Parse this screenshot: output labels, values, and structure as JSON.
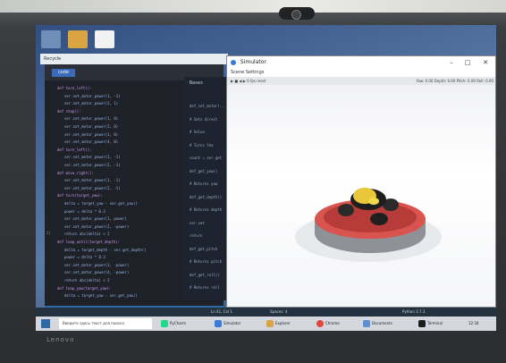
{
  "desktop": {
    "icon_labels": []
  },
  "explorer": {
    "title": "Recycle"
  },
  "code_window": {
    "tab_label": "code",
    "lines": [
      "def turn_left():",
      "    ser.set_motor_power(1, -1)",
      "    ser.set_motor_power(2, 1)",
      "def stop():",
      "    ser.set_motor_power(1, 0)",
      "    ser.set_motor_power(2, 0)",
      "    ser.set_motor_power(3, 0)",
      "    ser.set_motor_power(4, 0)",
      "def turn_left():",
      "    ser.set_motor_power(1, -1)",
      "    ser.set_motor_power(2, -1)",
      "def move_right():",
      "    ser.set_motor_power(1, -1)",
      "    ser.set_motor_power(2, -1)",
      "def turn(target_yaw):",
      "    delta = target_yaw - ser.get_yaw()",
      "    power = delta * 0.3",
      "    ser.set_motor_power(1, power)",
      "    ser.set_motor_power(2, -power)",
      "    return abs(delta) < 2",
      "def loop_until(target_depth):",
      "    delta = target_depth - ser.get_depth()",
      "    power = delta * 0.3",
      "    ser.set_motor_power(3, -power)",
      "    ser.set_motor_power(4, -power)",
      "    return abs(delta) < 2",
      "def loop_yaw(target_yaw):",
      "    delta = target_yaw - ser.get_yaw()"
    ],
    "line_number": "41",
    "status_path": "C:/Users/2022/mission/example/try_out_pool.py"
  },
  "mid_pane": {
    "header": "Bases",
    "lines": [
      "def_set_motor(..",
      "# Sets direct",
      "# Value",
      "# Turns the",
      "count = ser.get",
      "def_get_yaw()",
      "# Returns yaw",
      "def_get_depth()",
      "# Returns depth",
      "ser.set",
      "return",
      "def_get_pitch",
      "# Returns pitch",
      "def_get_roll()",
      "# Returns roll"
    ]
  },
  "sim_window": {
    "title": "Simulator",
    "menu": "Scene  Settings",
    "toolbar_left": "▶ ■ ◀ ▶  6 fps  reset",
    "toolbar_right": "Yaw: 0.00  Depth: 0.00  Pitch: 0.00  Roll: 0.00"
  },
  "statusbar": {
    "left": "Ln 41, Col 1",
    "mid": "Spaces: 4",
    "right": "Python 3.7.3"
  },
  "taskbar": {
    "search_placeholder": "Введите здесь текст для поиска",
    "items": [
      "PyCharm",
      "Simulator",
      "Explorer",
      "Chrome",
      "Documents",
      "Terminal"
    ],
    "clock": "12:34"
  },
  "brand": "Lenovo",
  "colors": {
    "accent": "#2d6aa8",
    "pool_rim": "#d9534f",
    "robot_body": "#e8c83a"
  }
}
